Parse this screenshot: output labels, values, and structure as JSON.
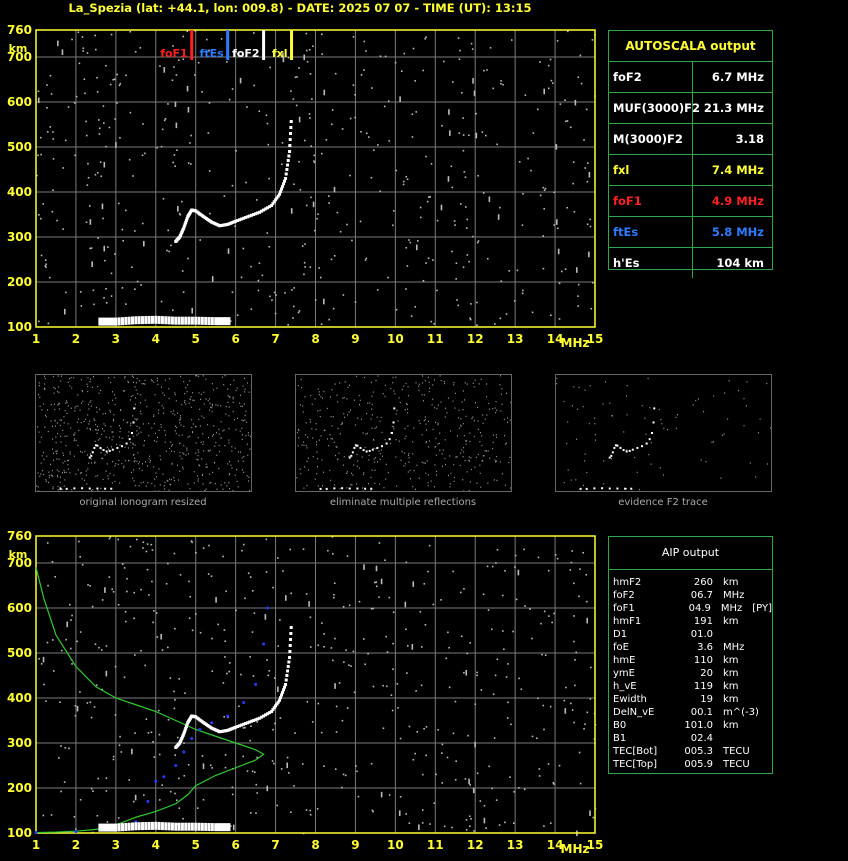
{
  "header": {
    "title": "La_Spezia (lat: +44.1, lon: 009.8) - DATE: 2025 07 07 - TIME (UT): 13:15"
  },
  "colors": {
    "grid": "#7a7a7a",
    "axis": "#ffff33",
    "trace": "#ffffff",
    "foF1": "#ff2020",
    "ftEs": "#2d7cff",
    "foF2": "#ffffff",
    "fxl": "#ffff33",
    "green": "#2ecc2e",
    "blue": "#1f3dff"
  },
  "chart_data": [
    {
      "type": "scatter",
      "title": "",
      "xlabel": "MHz",
      "ylabel": "km",
      "xlim": [
        1,
        15
      ],
      "ylim": [
        100,
        760
      ],
      "x_ticks": [
        "1",
        "2",
        "3",
        "4",
        "5",
        "6",
        "7",
        "8",
        "9",
        "10",
        "11",
        "12",
        "13",
        "14",
        "15"
      ],
      "y_ticks": [
        "100",
        "200",
        "300",
        "400",
        "500",
        "600",
        "700",
        "760"
      ],
      "markers": [
        {
          "name": "foF1",
          "x": 4.9
        },
        {
          "name": "ftEs",
          "x": 5.8
        },
        {
          "name": "foF2",
          "x": 6.7
        },
        {
          "name": "fxl",
          "x": 7.4
        }
      ],
      "traces": [
        {
          "name": "",
          "points": [
            [
              4.5,
              290
            ],
            [
              4.6,
              300
            ],
            [
              4.7,
              320
            ],
            [
              4.8,
              345
            ],
            [
              4.9,
              360
            ],
            [
              5.0,
              358
            ],
            [
              5.2,
              345
            ],
            [
              5.4,
              333
            ],
            [
              5.6,
              325
            ],
            [
              5.8,
              328
            ],
            [
              6.0,
              335
            ],
            [
              6.3,
              345
            ],
            [
              6.6,
              355
            ],
            [
              6.9,
              370
            ],
            [
              7.1,
              395
            ],
            [
              7.25,
              430
            ],
            [
              7.35,
              490
            ],
            [
              7.4,
              570
            ]
          ]
        },
        {
          "name": "",
          "points": [
            [
              2.6,
              112
            ],
            [
              3.0,
              112
            ],
            [
              3.5,
              115
            ],
            [
              4.0,
              116
            ],
            [
              4.5,
              114
            ],
            [
              5.0,
              114
            ],
            [
              5.5,
              113
            ],
            [
              5.9,
              113
            ]
          ]
        }
      ]
    },
    {
      "type": "line",
      "title": "",
      "xlabel": "MHz",
      "ylabel": "km",
      "xlim": [
        1,
        15
      ],
      "ylim": [
        100,
        760
      ],
      "x_ticks": [
        "1",
        "2",
        "3",
        "4",
        "5",
        "6",
        "7",
        "8",
        "9",
        "10",
        "11",
        "12",
        "13",
        "14",
        "15"
      ],
      "y_ticks": [
        "100",
        "200",
        "300",
        "400",
        "500",
        "600",
        "700",
        "760"
      ],
      "series": [
        {
          "name": "",
          "values": [
            [
              1.0,
              690
            ],
            [
              1.2,
              620
            ],
            [
              1.5,
              540
            ],
            [
              2.0,
              470
            ],
            [
              2.5,
              425
            ],
            [
              3.0,
              400
            ],
            [
              3.5,
              385
            ],
            [
              4.0,
              370
            ],
            [
              4.5,
              350
            ],
            [
              5.0,
              330
            ],
            [
              5.5,
              315
            ],
            [
              6.0,
              300
            ],
            [
              6.5,
              285
            ],
            [
              6.7,
              275
            ],
            [
              6.5,
              262
            ],
            [
              6.0,
              245
            ],
            [
              5.5,
              228
            ],
            [
              5.0,
              205
            ],
            [
              4.8,
              185
            ],
            [
              4.5,
              165
            ],
            [
              4.0,
              148
            ],
            [
              3.5,
              135
            ],
            [
              3.0,
              118
            ],
            [
              2.5,
              108
            ],
            [
              2.0,
              104
            ],
            [
              1.5,
              102
            ],
            [
              1.0,
              101
            ]
          ]
        },
        {
          "name": "",
          "points": [
            [
              1.0,
              101
            ],
            [
              2.0,
              103
            ],
            [
              3.0,
              110
            ],
            [
              3.5,
              125
            ],
            [
              3.8,
              170
            ],
            [
              4.0,
              215
            ],
            [
              4.2,
              225
            ],
            [
              4.5,
              250
            ],
            [
              4.7,
              280
            ],
            [
              4.9,
              310
            ],
            [
              5.1,
              330
            ],
            [
              5.4,
              345
            ],
            [
              5.8,
              360
            ],
            [
              6.2,
              390
            ],
            [
              6.5,
              430
            ],
            [
              6.7,
              520
            ],
            [
              6.8,
              600
            ]
          ]
        }
      ],
      "traces": [
        {
          "name": "",
          "points": [
            [
              4.5,
              290
            ],
            [
              4.6,
              300
            ],
            [
              4.7,
              320
            ],
            [
              4.8,
              345
            ],
            [
              4.9,
              360
            ],
            [
              5.0,
              358
            ],
            [
              5.2,
              345
            ],
            [
              5.4,
              333
            ],
            [
              5.6,
              325
            ],
            [
              5.8,
              328
            ],
            [
              6.0,
              335
            ],
            [
              6.3,
              345
            ],
            [
              6.6,
              355
            ],
            [
              6.9,
              370
            ],
            [
              7.1,
              395
            ],
            [
              7.25,
              430
            ],
            [
              7.35,
              490
            ],
            [
              7.4,
              570
            ]
          ]
        },
        {
          "name": "",
          "points": [
            [
              2.6,
              112
            ],
            [
              3.0,
              112
            ],
            [
              3.5,
              115
            ],
            [
              4.0,
              116
            ],
            [
              4.5,
              114
            ],
            [
              5.0,
              114
            ],
            [
              5.5,
              113
            ],
            [
              5.9,
              113
            ]
          ]
        }
      ]
    }
  ],
  "autoscala": {
    "title": "AUTOSCALA output",
    "rows": [
      {
        "label": "foF2",
        "value": "6.7 MHz",
        "color": "#ffffff"
      },
      {
        "label": "MUF(3000)F2",
        "value": "21.3 MHz",
        "color": "#ffffff"
      },
      {
        "label": "M(3000)F2",
        "value": "3.18",
        "color": "#ffffff"
      },
      {
        "label": "fxl",
        "value": "7.4 MHz",
        "color": "#ffff33"
      },
      {
        "label": "foF1",
        "value": "4.9 MHz",
        "color": "#ff2020"
      },
      {
        "label": "ftEs",
        "value": "5.8 MHz",
        "color": "#2d7cff"
      },
      {
        "label": "h'Es",
        "value": "104     km",
        "color": "#ffffff"
      }
    ]
  },
  "thumbnails": [
    {
      "caption": "original ionogram resized"
    },
    {
      "caption": "eliminate multiple reflections"
    },
    {
      "caption": "evidence F2 trace"
    }
  ],
  "aip": {
    "title": "AIP output",
    "rows": [
      [
        "hmF2",
        "260",
        "km",
        ""
      ],
      [
        "foF2",
        "06.7",
        "MHz",
        ""
      ],
      [
        "foF1",
        "04.9",
        "MHz",
        "[PY]"
      ],
      [
        "hmF1",
        "191",
        "km",
        ""
      ],
      [
        "D1",
        "01.0",
        "",
        ""
      ],
      [
        "foE",
        "3.6",
        "MHz",
        ""
      ],
      [
        "hmE",
        "110",
        "km",
        ""
      ],
      [
        "ymE",
        "20",
        "km",
        ""
      ],
      [
        "h_vE",
        "119",
        "km",
        ""
      ],
      [
        "Ewidth",
        "19",
        "km",
        ""
      ],
      [
        "DelN_vE",
        "00.1",
        "m^(-3)",
        ""
      ],
      [
        "B0",
        "101.0",
        "km",
        ""
      ],
      [
        "B1",
        "02.4",
        "",
        ""
      ],
      [
        "TEC[Bot]",
        "005.3",
        "TECU",
        ""
      ],
      [
        "TEC[Top]",
        "005.9",
        "TECU",
        ""
      ]
    ]
  }
}
